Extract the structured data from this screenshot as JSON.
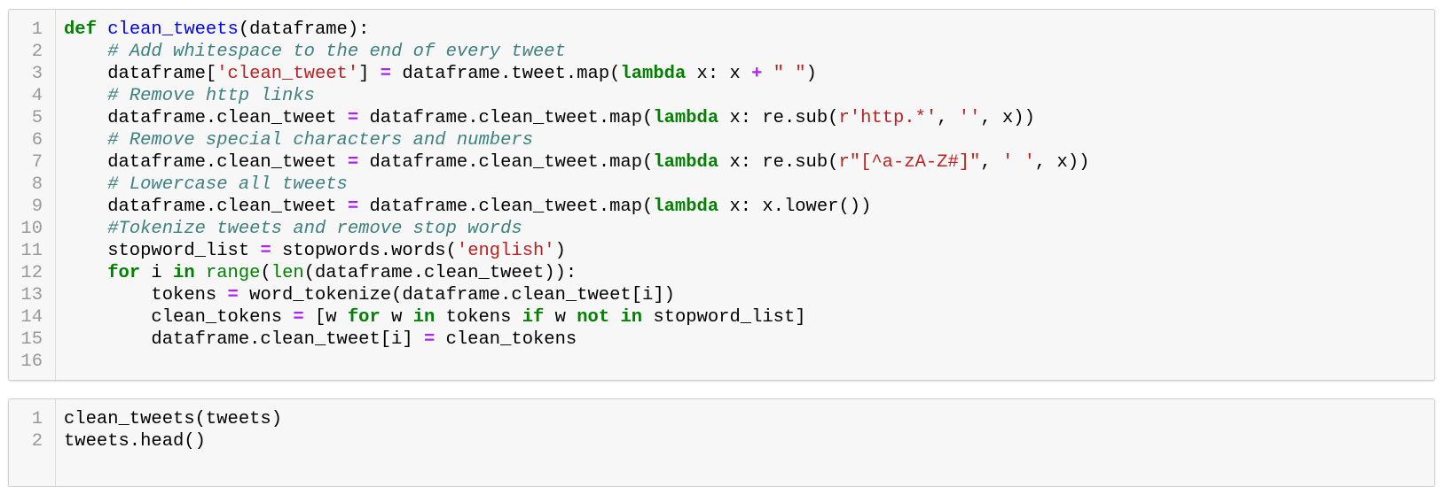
{
  "cells": [
    {
      "lines": [
        {
          "n": "1",
          "tokens": [
            {
              "t": "def",
              "c": "kw"
            },
            {
              "t": " "
            },
            {
              "t": "clean_tweets",
              "c": "fn"
            },
            {
              "t": "(dataframe):"
            }
          ]
        },
        {
          "n": "2",
          "tokens": [
            {
              "t": "    "
            },
            {
              "t": "# Add whitespace to the end of every tweet",
              "c": "cm"
            }
          ]
        },
        {
          "n": "3",
          "tokens": [
            {
              "t": "    dataframe["
            },
            {
              "t": "'clean_tweet'",
              "c": "str"
            },
            {
              "t": "] "
            },
            {
              "t": "=",
              "c": "op"
            },
            {
              "t": " dataframe.tweet.map("
            },
            {
              "t": "lambda",
              "c": "kw"
            },
            {
              "t": " x: x "
            },
            {
              "t": "+",
              "c": "op"
            },
            {
              "t": " "
            },
            {
              "t": "\" \"",
              "c": "str"
            },
            {
              "t": ")"
            }
          ]
        },
        {
          "n": "4",
          "tokens": [
            {
              "t": "    "
            },
            {
              "t": "# Remove http links",
              "c": "cm"
            }
          ]
        },
        {
          "n": "5",
          "tokens": [
            {
              "t": "    dataframe.clean_tweet "
            },
            {
              "t": "=",
              "c": "op"
            },
            {
              "t": " dataframe.clean_tweet.map("
            },
            {
              "t": "lambda",
              "c": "kw"
            },
            {
              "t": " x: re.sub("
            },
            {
              "t": "r'http.*'",
              "c": "str"
            },
            {
              "t": ", "
            },
            {
              "t": "''",
              "c": "str"
            },
            {
              "t": ", x))"
            }
          ]
        },
        {
          "n": "6",
          "tokens": [
            {
              "t": "    "
            },
            {
              "t": "# Remove special characters and numbers",
              "c": "cm"
            }
          ]
        },
        {
          "n": "7",
          "tokens": [
            {
              "t": "    dataframe.clean_tweet "
            },
            {
              "t": "=",
              "c": "op"
            },
            {
              "t": " dataframe.clean_tweet.map("
            },
            {
              "t": "lambda",
              "c": "kw"
            },
            {
              "t": " x: re.sub("
            },
            {
              "t": "r\"[^a-zA-Z#]\"",
              "c": "str"
            },
            {
              "t": ", "
            },
            {
              "t": "' '",
              "c": "str"
            },
            {
              "t": ", x))"
            }
          ]
        },
        {
          "n": "8",
          "tokens": [
            {
              "t": "    "
            },
            {
              "t": "# Lowercase all tweets",
              "c": "cm"
            }
          ]
        },
        {
          "n": "9",
          "tokens": [
            {
              "t": "    dataframe.clean_tweet "
            },
            {
              "t": "=",
              "c": "op"
            },
            {
              "t": " dataframe.clean_tweet.map("
            },
            {
              "t": "lambda",
              "c": "kw"
            },
            {
              "t": " x: x.lower())"
            }
          ]
        },
        {
          "n": "10",
          "tokens": [
            {
              "t": "    "
            },
            {
              "t": "#Tokenize tweets and remove stop words",
              "c": "cm"
            }
          ]
        },
        {
          "n": "11",
          "tokens": [
            {
              "t": "    stopword_list "
            },
            {
              "t": "=",
              "c": "op"
            },
            {
              "t": " stopwords.words("
            },
            {
              "t": "'english'",
              "c": "str"
            },
            {
              "t": ")"
            }
          ]
        },
        {
          "n": "12",
          "tokens": [
            {
              "t": "    "
            },
            {
              "t": "for",
              "c": "kw"
            },
            {
              "t": " i "
            },
            {
              "t": "in",
              "c": "kw"
            },
            {
              "t": " "
            },
            {
              "t": "range",
              "c": "bi"
            },
            {
              "t": "("
            },
            {
              "t": "len",
              "c": "bi"
            },
            {
              "t": "(dataframe.clean_tweet)):"
            }
          ]
        },
        {
          "n": "13",
          "tokens": [
            {
              "t": "        tokens "
            },
            {
              "t": "=",
              "c": "op"
            },
            {
              "t": " word_tokenize(dataframe.clean_tweet[i])"
            }
          ]
        },
        {
          "n": "14",
          "tokens": [
            {
              "t": "        clean_tokens "
            },
            {
              "t": "=",
              "c": "op"
            },
            {
              "t": " [w "
            },
            {
              "t": "for",
              "c": "kw"
            },
            {
              "t": " w "
            },
            {
              "t": "in",
              "c": "kw"
            },
            {
              "t": " tokens "
            },
            {
              "t": "if",
              "c": "kw"
            },
            {
              "t": " w "
            },
            {
              "t": "not",
              "c": "kw"
            },
            {
              "t": " "
            },
            {
              "t": "in",
              "c": "kw"
            },
            {
              "t": " stopword_list]"
            }
          ]
        },
        {
          "n": "15",
          "tokens": [
            {
              "t": "        dataframe.clean_tweet[i] "
            },
            {
              "t": "=",
              "c": "op"
            },
            {
              "t": " clean_tokens"
            }
          ]
        },
        {
          "n": "16",
          "tokens": []
        }
      ]
    },
    {
      "lines": [
        {
          "n": "1",
          "tokens": [
            {
              "t": "clean_tweets(tweets)"
            }
          ]
        },
        {
          "n": "2",
          "tokens": [
            {
              "t": "tweets.head()"
            }
          ]
        }
      ]
    }
  ]
}
